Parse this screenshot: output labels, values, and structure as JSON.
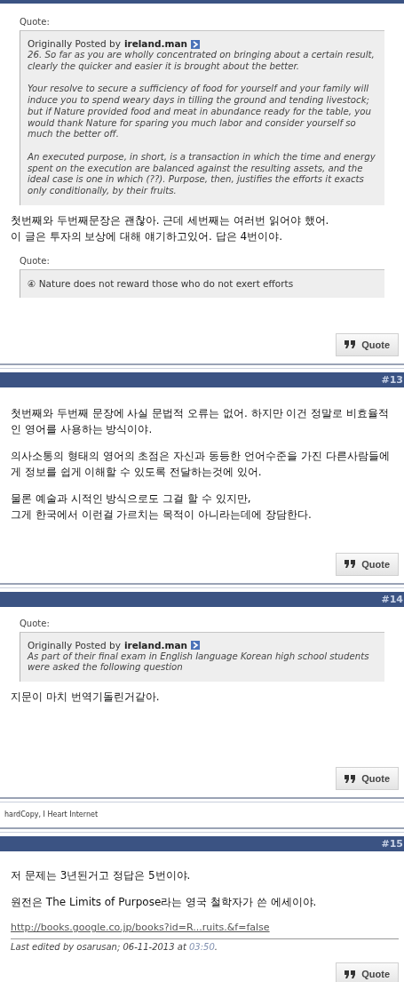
{
  "posts": [
    {
      "blocks": [
        {
          "kind": "quote",
          "label": "Quote:",
          "posted_by_label": "Originally Posted by",
          "author": "ireland.man",
          "paragraphs": [
            "26. So far as you are wholly concentrated on bringing about a certain result, clearly the quicker and easier it is brought about the better.",
            "Your resolve to secure a sufficiency of food for yourself and your family will induce you to spend weary days in tilling the ground and tending livestock; but if Nature provided food and meat in abundance ready for the table, you would thank Nature for sparing you much labor and consider yourself so much the better off.",
            "An executed purpose, in short, is a transaction in which the time and energy spent on the execution are balanced against the resulting assets, and the ideal case is one in which (??). Purpose, then, justifies the efforts it exacts only conditionally, by their fruits."
          ]
        },
        {
          "kind": "text",
          "lines": [
            "첫번째와 두번째문장은 괜찮아. 근데 세번째는 여러번 읽어야 했어.",
            "이 글은 투자의 보상에 대해 얘기하고있어. 답은 4번이야."
          ]
        },
        {
          "kind": "quote",
          "label": "Quote:",
          "paragraphs": [
            "④ Nature does not reward those who do not exert efforts"
          ]
        }
      ],
      "quote_button": "Quote"
    },
    {
      "number": "#13",
      "blocks": [
        {
          "kind": "text",
          "lines": [
            "첫번째와 두번째 문장에 사실 문법적 오류는 없어. 하지만 이건 정말로 비효율적인 영어를 사용하는 방식이야."
          ]
        },
        {
          "kind": "text",
          "lines": [
            "의사소통의 형태의 영어의 초점은 자신과 동등한 언어수준을 가진 다른사람들에게 정보를 쉽게 이해할 수 있도록 전달하는것에 있어."
          ]
        },
        {
          "kind": "text",
          "lines": [
            "물론 예술과 시적인 방식으로도 그걸 할 수 있지만,",
            "그게 한국에서 이런걸 가르치는 목적이 아니라는데에 장담한다."
          ]
        }
      ],
      "quote_button": "Quote"
    },
    {
      "number": "#14",
      "blocks": [
        {
          "kind": "quote",
          "label": "Quote:",
          "posted_by_label": "Originally Posted by",
          "author": "ireland.man",
          "paragraphs": [
            "As part of their final exam in English language Korean high school students were asked the following question"
          ]
        },
        {
          "kind": "text",
          "lines": [
            "지문이 마치 번역기돌린거같아."
          ]
        }
      ],
      "quote_button": "Quote",
      "signature": "hardCopy, I Heart Internet"
    },
    {
      "number": "#15",
      "blocks": [
        {
          "kind": "text",
          "lines": [
            "저 문제는 3년된거고 정답은 5번이야."
          ]
        },
        {
          "kind": "text",
          "lines": [
            "원전은 The Limits of Purpose라는 영국 철학자가 쓴 에세이야."
          ]
        },
        {
          "kind": "link",
          "text": "http://books.google.co.jp/books?id=R...ruits.&f=false"
        },
        {
          "kind": "edited",
          "text": "Last edited by osarusan; 06-11-2013 at ",
          "time": "03:50",
          "end": "."
        }
      ],
      "quote_button": "Quote"
    }
  ]
}
